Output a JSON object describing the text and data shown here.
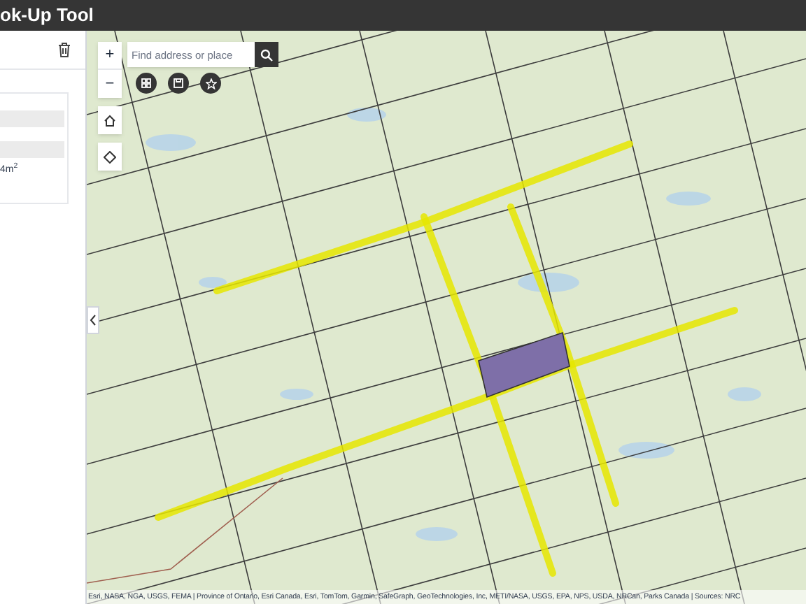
{
  "header": {
    "title": "ok-Up Tool"
  },
  "panel": {
    "area_text": "4m$^{2}$"
  },
  "map": {
    "search": {
      "placeholder": "Find address or place"
    },
    "zoom_in": "+",
    "zoom_out": "−",
    "attribution": "Esri, NASA, NGA, USGS, FEMA | Province of Ontario, Esri Canada, Esri, TomTom, Garmin, SafeGraph, GeoTechnologies, Inc, METI/NASA, USGS, EPA, NPS, USDA, NRCan, Parks Canada | Sources: NRC"
  }
}
